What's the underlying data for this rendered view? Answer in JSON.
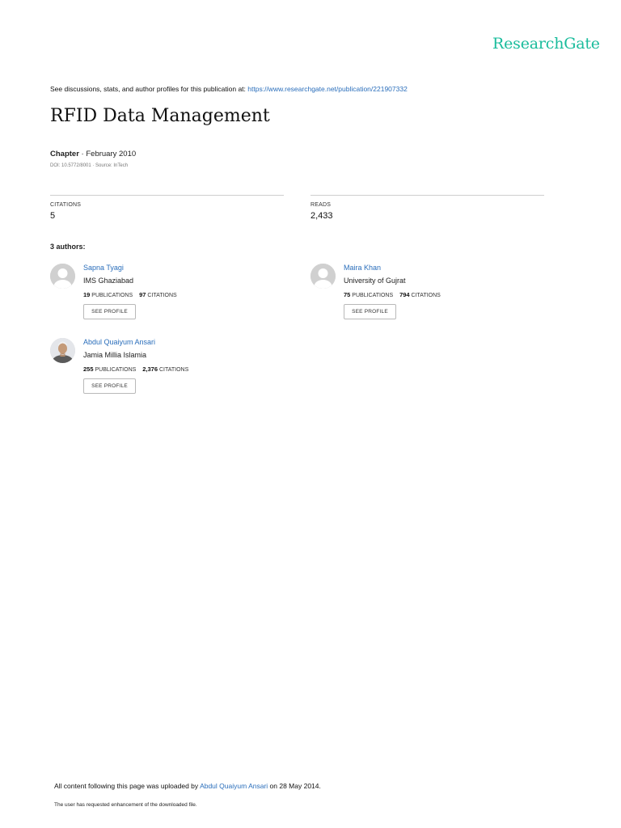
{
  "header": {
    "logo_text": "ResearchGate",
    "see_text": "See discussions, stats, and author profiles for this publication at:",
    "see_link": "https://www.researchgate.net/publication/221907332"
  },
  "publication": {
    "title": "RFID Data Management",
    "type": "Chapter",
    "date_sep": " · ",
    "date": "February 2010",
    "doi_source": "DOI: 10.5772/8001 · Source: InTech"
  },
  "stats": {
    "citations_label": "CITATIONS",
    "citations_value": "5",
    "reads_label": "READS",
    "reads_value": "2,433"
  },
  "authors_heading": "3 authors:",
  "authors": [
    {
      "name": "Sapna Tyagi",
      "institution": "IMS Ghaziabad",
      "publications": "19",
      "publications_label": "PUBLICATIONS",
      "citations": "97",
      "citations_label": "CITATIONS",
      "button": "SEE PROFILE"
    },
    {
      "name": "Maira Khan",
      "institution": "University of Gujrat",
      "publications": "75",
      "publications_label": "PUBLICATIONS",
      "citations": "794",
      "citations_label": "CITATIONS",
      "button": "SEE PROFILE"
    },
    {
      "name": "Abdul Quaiyum Ansari",
      "institution": "Jamia Millia Islamia",
      "publications": "255",
      "publications_label": "PUBLICATIONS",
      "citations": "2,376",
      "citations_label": "CITATIONS",
      "button": "SEE PROFILE"
    }
  ],
  "footer": {
    "upload_prefix": "All content following this page was uploaded by",
    "uploader": "Abdul Quaiyum Ansari",
    "upload_suffix": "on 28 May 2014.",
    "note": "The user has requested enhancement of the downloaded file."
  },
  "colors": {
    "brand": "#1abc9c",
    "link": "#2a6ebb"
  }
}
